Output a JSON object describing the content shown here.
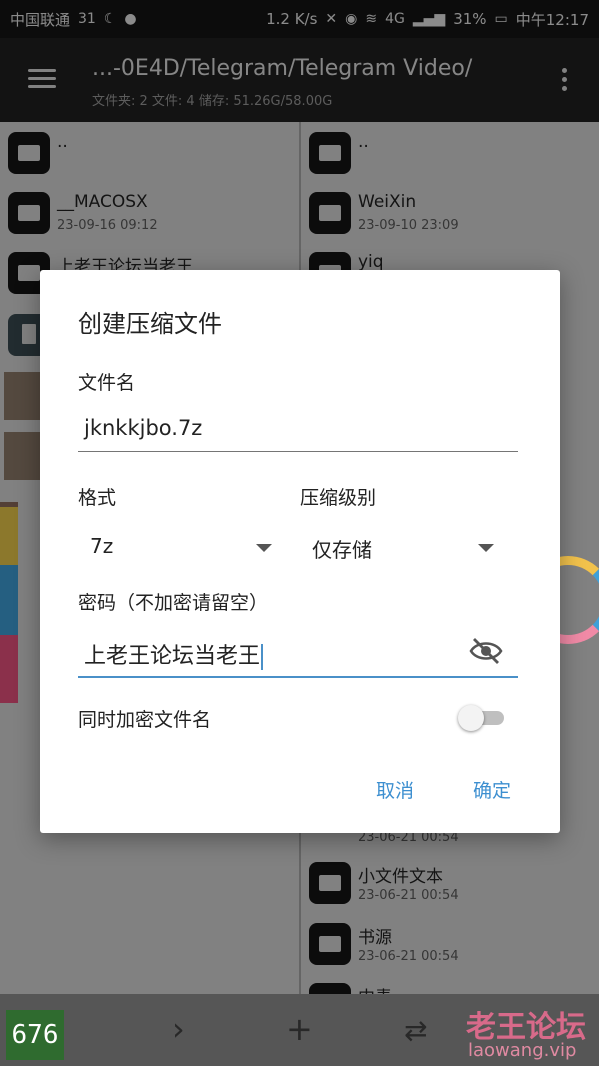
{
  "status_bar": {
    "carrier": "中国联通",
    "badge": "31",
    "net_speed": "1.2 K/s",
    "network": "4G",
    "battery": "31%",
    "time": "中午12:17"
  },
  "app_bar": {
    "path": "...-0E4D/Telegram/Telegram Video/",
    "stats": "文件夹: 2   文件: 4   储存: 51.26G/58.00G"
  },
  "left_pane": {
    "items": [
      {
        "name": "..",
        "date": ""
      },
      {
        "name": "__MACOSX",
        "date": "23-09-16 09:12"
      },
      {
        "name": "上老王论坛当老王",
        "date": ""
      }
    ]
  },
  "right_pane": {
    "items": [
      {
        "name": "..",
        "date": ""
      },
      {
        "name": "WeiXin",
        "date": "23-09-10 23:09"
      },
      {
        "name": "yiq",
        "date": ""
      },
      {
        "name": "",
        "date": "23-06-21 00:54"
      },
      {
        "name": "小文件文本",
        "date": "23-06-21 00:54"
      },
      {
        "name": "书源",
        "date": "23-06-21 00:54"
      },
      {
        "name": "中青",
        "date": ""
      }
    ]
  },
  "dialog": {
    "title": "创建压缩文件",
    "filename_label": "文件名",
    "filename_value": "jknkkjbo.7z",
    "format_label": "格式",
    "format_value": "7z",
    "level_label": "压缩级别",
    "level_value": "仅存储",
    "password_label": "密码（不加密请留空）",
    "password_value": "上老王论坛当老王",
    "encrypt_names_label": "同时加密文件名",
    "encrypt_names_on": false,
    "cancel": "取消",
    "ok": "确定"
  },
  "bottom_bar": {
    "counter": "676",
    "back_icon": "chevron-left-icon",
    "forward_icon": "chevron-right-icon",
    "add_icon": "plus-icon",
    "swap_icon": "swap-icon"
  },
  "watermark": {
    "cn": "老王论坛",
    "url": "laowang.vip"
  },
  "colors": {
    "accent": "#3d8fd0",
    "dialog_bg": "#ffffff",
    "appbar_bg": "#202020"
  }
}
